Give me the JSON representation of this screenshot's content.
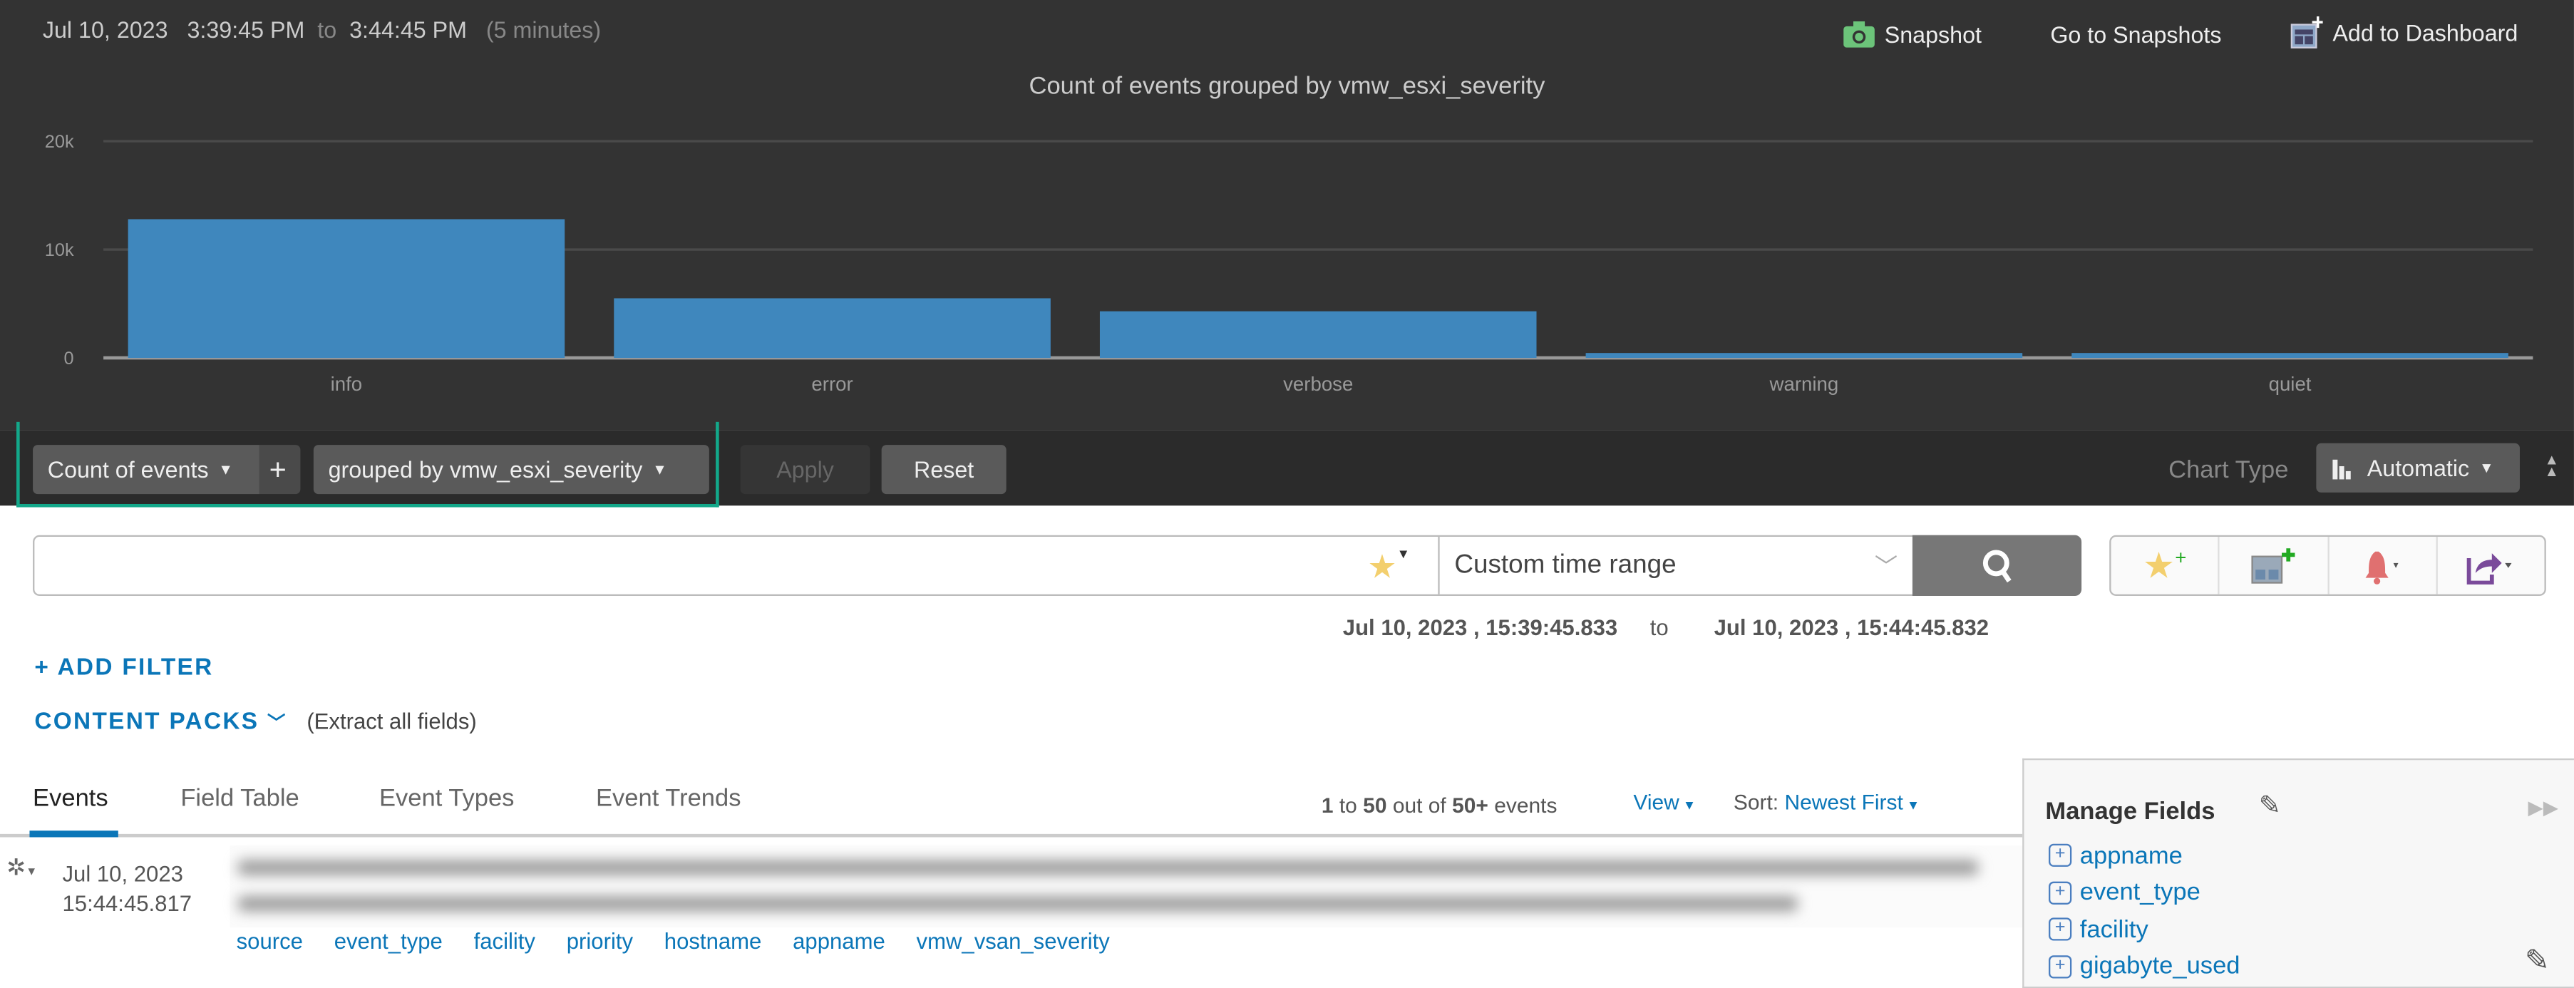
{
  "header": {
    "date": "Jul 10, 2023",
    "start": "3:39:45 PM",
    "to": "to",
    "end": "3:44:45 PM",
    "duration": "(5 minutes)"
  },
  "actions": {
    "snapshot": "Snapshot",
    "go_to_snapshots": "Go to Snapshots",
    "add_to_dashboard": "Add to Dashboard"
  },
  "chart_data": {
    "type": "bar",
    "title": "Count of events grouped by vmw_esxi_severity",
    "categories": [
      "info",
      "error",
      "verbose",
      "warning",
      "quiet"
    ],
    "values": [
      12800,
      5500,
      4300,
      450,
      450
    ],
    "ylim": [
      0,
      20000
    ],
    "yticks": [
      {
        "v": 0,
        "label": "0"
      },
      {
        "v": 10000,
        "label": "10k"
      },
      {
        "v": 20000,
        "label": "20k"
      }
    ],
    "grid": true,
    "bar_color": "#3f87bd"
  },
  "toolbar": {
    "aggregate": "Count of events",
    "add": "+",
    "group_by": "grouped by vmw_esxi_severity",
    "apply": "Apply",
    "reset": "Reset",
    "chart_type_label": "Chart Type",
    "chart_type": "Automatic"
  },
  "search": {
    "query": "",
    "placeholder": "",
    "time_range": "Custom time range"
  },
  "range": {
    "from": "Jul 10, 2023 ,  15:39:45.833",
    "to": "to",
    "until": "Jul 10, 2023 ,  15:44:45.832"
  },
  "filters": {
    "add_filter": "+ ADD FILTER",
    "content_packs": "CONTENT PACKS",
    "extract": "(Extract all fields)"
  },
  "tabs": [
    {
      "label": "Events",
      "active": true
    },
    {
      "label": "Field Table"
    },
    {
      "label": "Event Types"
    },
    {
      "label": "Event Trends"
    }
  ],
  "results": {
    "from": "1",
    "to_word": "to",
    "to": "50",
    "out_of": "out of",
    "total": "50+",
    "events": "events",
    "view": "View",
    "sort_label": "Sort:",
    "sort_value": "Newest First"
  },
  "event": {
    "date": "Jul 10, 2023",
    "time": "15:44:45.817",
    "fields": [
      "source",
      "event_type",
      "facility",
      "priority",
      "hostname",
      "appname",
      "vmw_vsan_severity"
    ]
  },
  "manage_fields": {
    "title": "Manage Fields",
    "items": [
      "appname",
      "event_type",
      "facility",
      "gigabyte_used"
    ]
  }
}
